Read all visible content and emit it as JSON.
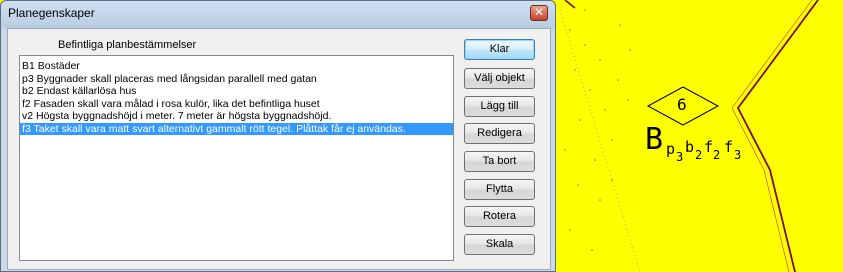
{
  "window": {
    "title": "Planegenskaper"
  },
  "close_glyph": "✕",
  "list_group_label": "Befintliga planbestämmelser",
  "list_items": [
    "B1 Bostäder",
    "p3 Byggnader skall placeras med långsidan parallell med gatan",
    "b2 Endast källarlösa hus",
    "f2 Fasaden skall vara målad i rosa kulör, lika det befintliga huset",
    "v2 Högsta byggnadshöjd i meter. 7 meter är högsta byggnadshöjd.",
    "f3 Taket skall vara matt svart alternativt gammalt rött tegel. Plåttak får ej användas."
  ],
  "selected_index": 5,
  "buttons": {
    "klar": "Klar",
    "valj_objekt": "Välj objekt",
    "lagg_till": "Lägg till",
    "redigera": "Redigera",
    "ta_bort": "Ta bort",
    "flytta": "Flytta",
    "rotera": "Rotera",
    "skala": "Skala"
  },
  "map": {
    "background_color": "#ffff00",
    "area_number": "6",
    "label_main": "B",
    "label_codes": [
      "p",
      "3",
      "b",
      "2",
      "f",
      "2",
      "f",
      "3"
    ]
  }
}
